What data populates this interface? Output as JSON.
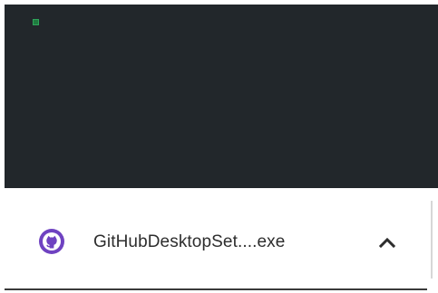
{
  "download_shelf": {
    "items": [
      {
        "file_name": "GitHubDesktopSet....exe",
        "file_icon": "github-icon",
        "menu_icon": "chevron-up-icon"
      }
    ]
  },
  "colors": {
    "content_background": "#22272b",
    "indicator_green": "#1f7a3f",
    "icon_purple": "#6f42c1",
    "text": "#2d2d2d"
  }
}
